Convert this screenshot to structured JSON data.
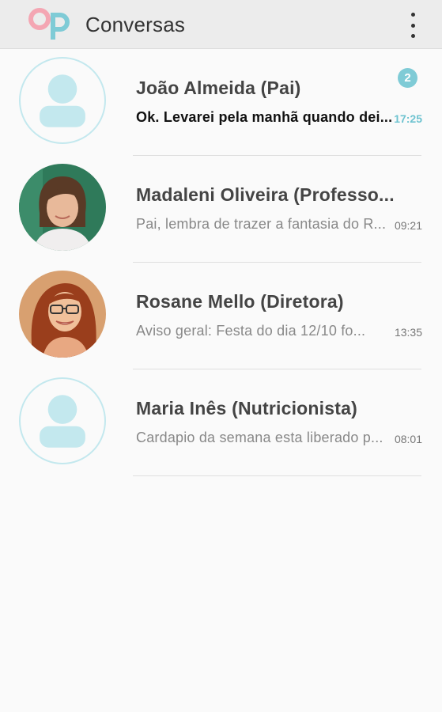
{
  "appbar": {
    "title": "Conversas",
    "logo_icon": "app-logo",
    "menu_icon": "more-vertical-icon",
    "colors": {
      "logo_pink": "#f4a6b3",
      "logo_teal": "#7fcbd6"
    }
  },
  "conversations": [
    {
      "name": "João Almeida (Pai)",
      "preview": "Ok. Levarei pela manhã quando dei...",
      "time": "17:25",
      "unread_count": "2",
      "unread": true,
      "avatar": "placeholder"
    },
    {
      "name": "Madaleni Oliveira (Professo...",
      "preview": "Pai, lembra de trazer a fantasia do R...",
      "time": "09:21",
      "unread": false,
      "avatar": "photo"
    },
    {
      "name": "Rosane Mello (Diretora)",
      "preview": "Aviso geral: Festa do dia 12/10 fo...",
      "time": "13:35",
      "unread": false,
      "avatar": "photo"
    },
    {
      "name": "Maria Inês (Nutricionista)",
      "preview": "Cardapio da semana esta liberado p...",
      "time": "08:01",
      "unread": false,
      "avatar": "placeholder"
    }
  ],
  "colors": {
    "accent": "#7fcbd6",
    "placeholder_border": "#c3e8ee",
    "background": "#fafafa"
  }
}
